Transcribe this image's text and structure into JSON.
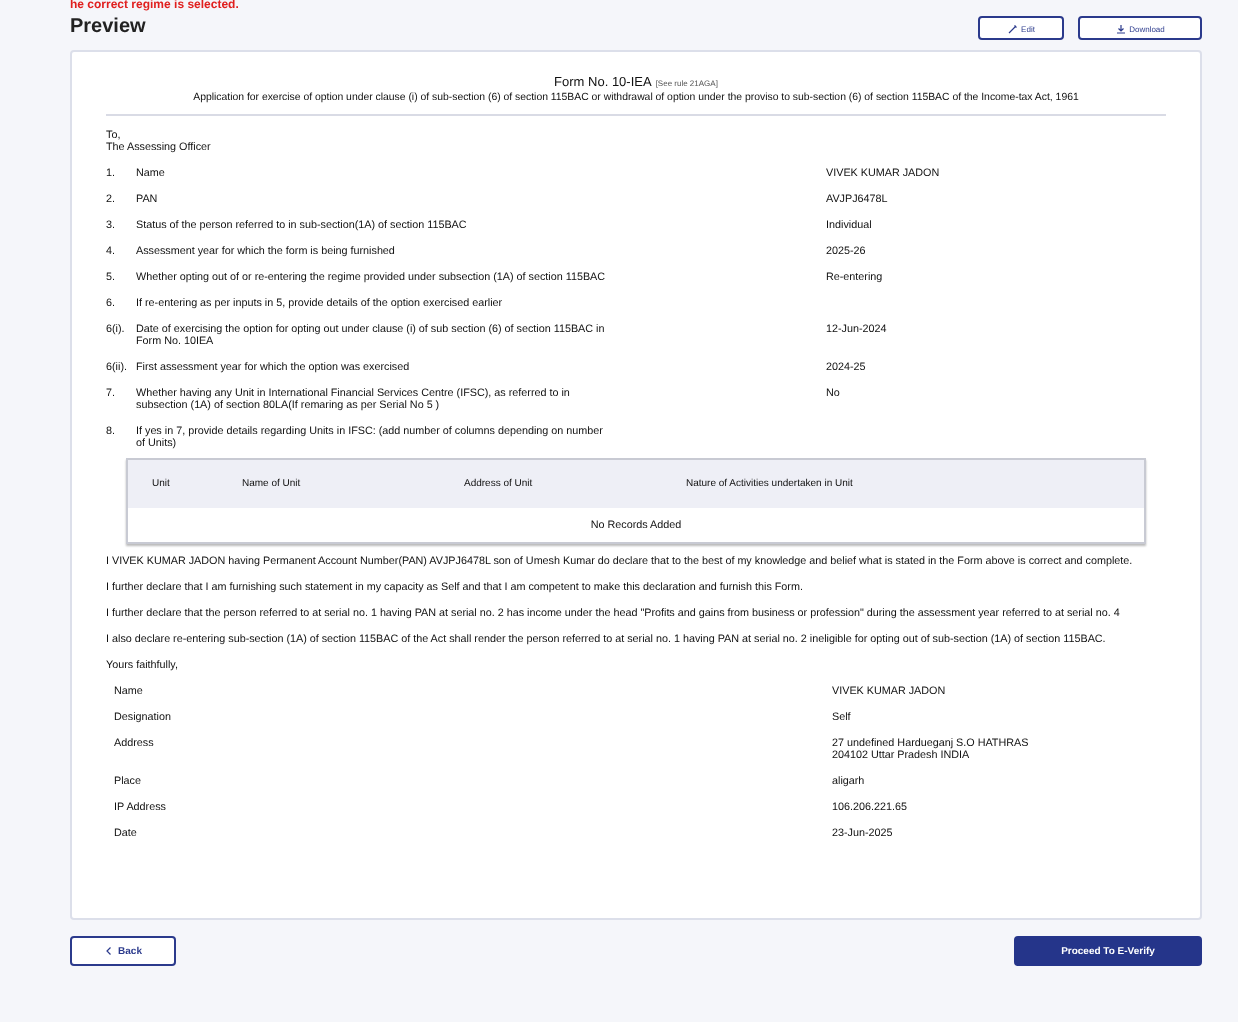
{
  "notice": "he correct regime is selected.",
  "title": "Preview",
  "top_buttons": [
    {
      "kind": "edit",
      "label": "Edit"
    },
    {
      "kind": "download",
      "label": "Download"
    }
  ],
  "form": {
    "heading": "Form No. 10-IEA",
    "rule_ref": "[See rule 21AGA]",
    "subtitle": "Application for exercise of option under clause (i) of sub-section (6) of section 115BAC or withdrawal of option under the proviso to sub-section (6) of section 115BAC of the Income-tax Act, 1961",
    "to": "To,",
    "officer": "The Assessing Officer",
    "items": [
      {
        "no": "1.",
        "label": "Name",
        "value": "VIVEK KUMAR JADON"
      },
      {
        "no": "2.",
        "label": "PAN",
        "value": "AVJPJ6478L"
      },
      {
        "no": "3.",
        "label": "Status of the person referred to in sub-section(1A) of section 115BAC",
        "value": "Individual"
      },
      {
        "no": "4.",
        "label": "Assessment year for which the form is being furnished",
        "value": "2025-26"
      },
      {
        "no": "5.",
        "label": "Whether opting out of or re-entering the regime provided under subsection (1A) of section 115BAC",
        "value": "Re-entering"
      },
      {
        "no": "6.",
        "label": "If re-entering as per inputs in 5, provide details of the option exercised earlier"
      },
      {
        "no": "6(i).",
        "label": "Date of exercising the option for opting out under clause (i) of sub section (6) of section 115BAC in Form No. 10IEA",
        "value": "12-Jun-2024"
      },
      {
        "no": "6(ii).",
        "label": "First assessment year for which the option was exercised",
        "value": "2024-25"
      },
      {
        "no": "7.",
        "label": "Whether having any Unit in International Financial Services Centre (IFSC), as referred to in subsection (1A) of section 80LA(If remaring as per Serial No 5 )",
        "value": "No"
      },
      {
        "no": "8.",
        "label": "If yes in 7, provide details regarding Units in IFSC: (add number of columns depending on number of Units)"
      }
    ],
    "table": {
      "columns": [
        "Unit",
        "Name of Unit",
        "Address of Unit",
        "Nature of Activities undertaken in Unit"
      ],
      "empty": "No Records Added"
    },
    "declarations": [
      "I VIVEK KUMAR JADON having Permanent Account Number(PAN) AVJPJ6478L son of Umesh Kumar do declare that to the best of my knowledge and belief what is stated in the Form above is correct and complete.",
      "I further declare that I am furnishing such statement in my capacity as Self and that I am competent to make this declaration and furnish this Form.",
      "I further declare that the person referred to at serial no. 1 having PAN at serial no. 2 has income under the head \"Profits and gains from business or profession\" during the assessment year referred to at serial no. 4",
      "I also declare re-entering sub-section (1A) of section 115BAC of the Act shall render the person referred to at serial no. 1 having PAN at serial no. 2 ineligible for opting out of sub-section (1A) of section 115BAC."
    ],
    "closing": "Yours faithfully,",
    "signature": [
      {
        "label": "Name",
        "value": [
          "VIVEK KUMAR JADON"
        ]
      },
      {
        "label": "Designation",
        "value": [
          "Self"
        ]
      },
      {
        "label": "Address",
        "value": [
          "27 undefined Hardueganj S.O HATHRAS",
          "204102 Uttar Pradesh INDIA"
        ]
      },
      {
        "label": "Place",
        "value": [
          "aligarh"
        ]
      },
      {
        "label": "IP Address",
        "value": [
          "106.206.221.65"
        ]
      },
      {
        "label": "Date",
        "value": [
          "23-Jun-2025"
        ]
      }
    ]
  },
  "footer_buttons": [
    {
      "kind": "back",
      "label": "Back"
    },
    {
      "kind": "primary",
      "label": "Proceed To E-Verify"
    }
  ]
}
